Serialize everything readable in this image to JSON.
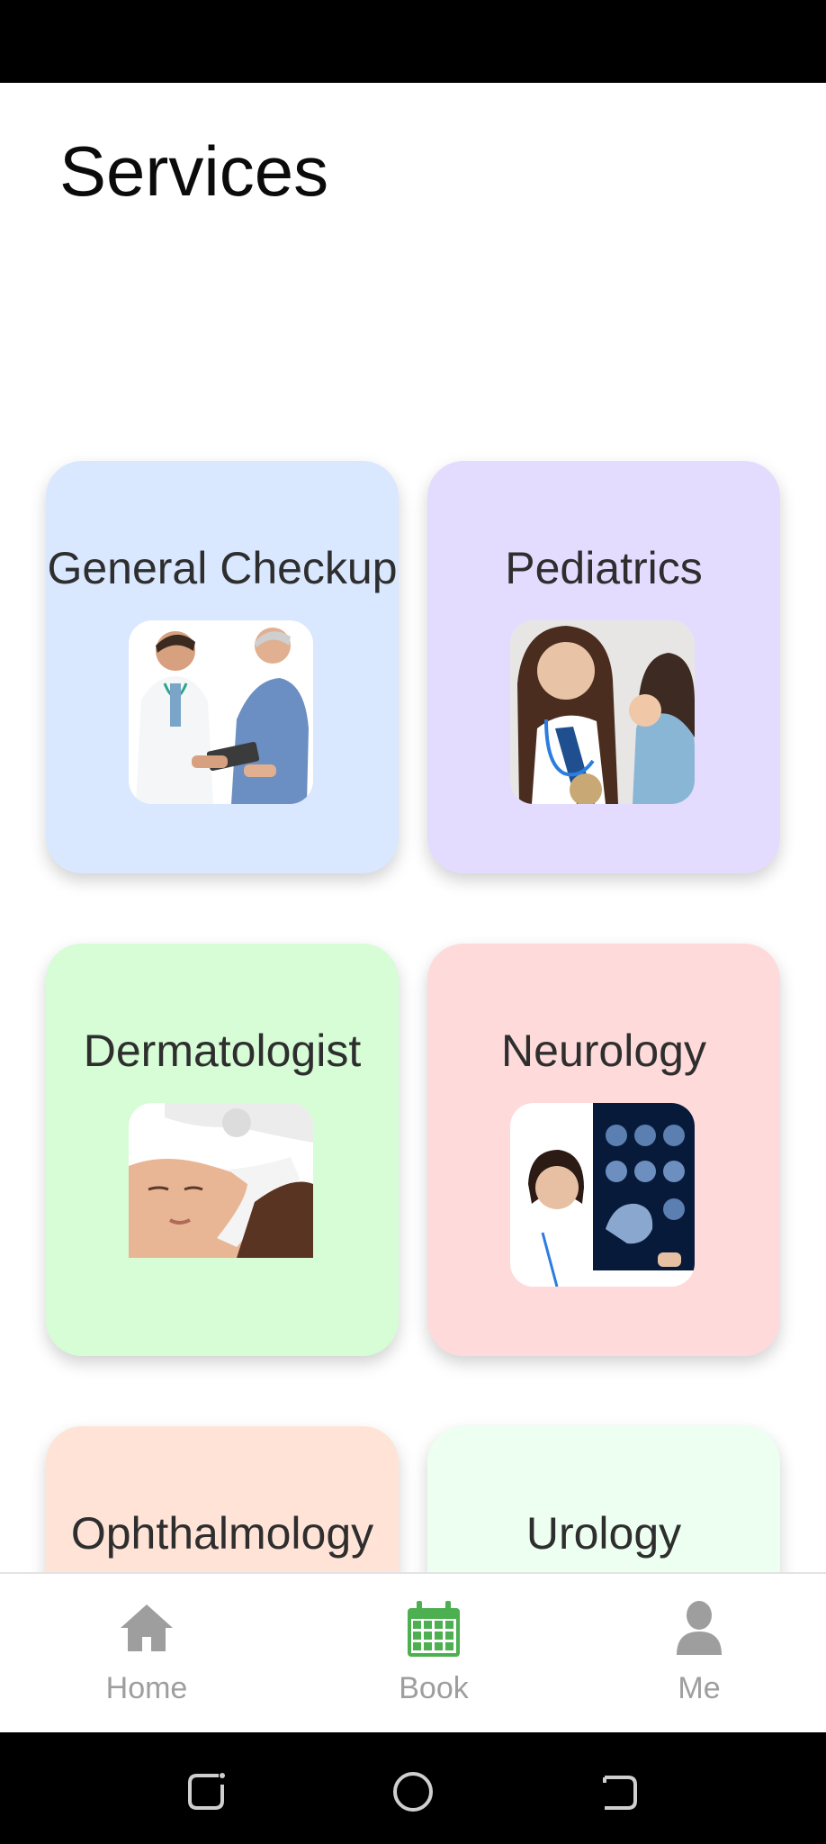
{
  "page": {
    "title": "Services"
  },
  "services": [
    {
      "label": "General Checkup",
      "color": "#d9e7ff"
    },
    {
      "label": "Pediatrics",
      "color": "#e4dcff"
    },
    {
      "label": "Dermatologist",
      "color": "#d6fdd6"
    },
    {
      "label": "Neurology",
      "color": "#ffdada"
    },
    {
      "label": "Ophthalmology",
      "color": "#ffe3d6"
    },
    {
      "label": "Urology",
      "color": "#edfff0"
    }
  ],
  "bottom_nav": {
    "items": [
      {
        "label": "Home",
        "icon": "home-icon",
        "active": false
      },
      {
        "label": "Book",
        "icon": "calendar-icon",
        "active": true
      },
      {
        "label": "Me",
        "icon": "person-icon",
        "active": false
      }
    ],
    "active_color": "#4caf50",
    "inactive_color": "#9e9e9e"
  },
  "system_nav": {
    "items": [
      "recent-apps-icon",
      "home-circle-icon",
      "back-icon"
    ]
  }
}
